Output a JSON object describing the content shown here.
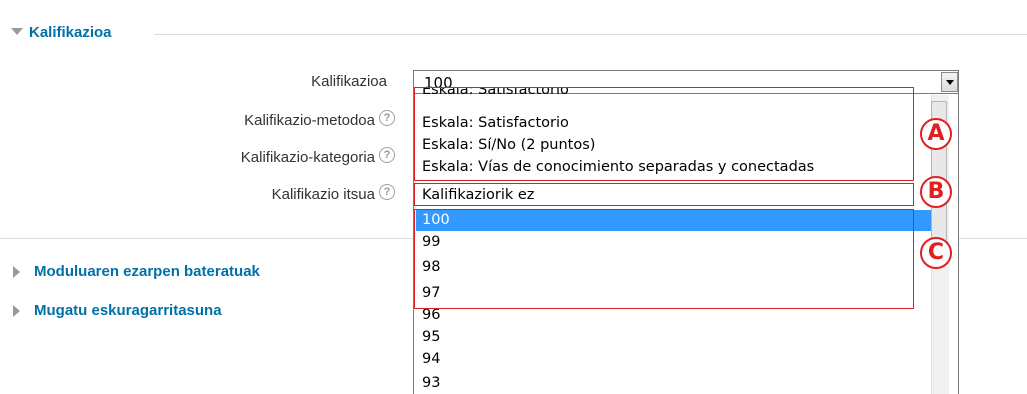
{
  "section": {
    "title": "Kalifikazioa"
  },
  "form": {
    "grade_label": "Kalifikazioa",
    "method_label": "Kalifikazio-metodoa",
    "category_label": "Kalifikazio-kategoria",
    "pass_label": "Kalifikazio itsua",
    "help_glyph": "?"
  },
  "select": {
    "value": "100",
    "options": [
      "Eskala: Satisfactorio",
      "Eskala: Satisfactorio",
      "Eskala: Sí/No (2 puntos)",
      "Eskala: Vías de conocimiento separadas y conectadas",
      "Kalifikaziorik ez",
      "100",
      "99",
      "98",
      "97",
      "96",
      "95",
      "94",
      "93"
    ],
    "selected_option": "100"
  },
  "annotations": {
    "a": "A",
    "b": "B",
    "c": "C"
  },
  "collapsed_sections": [
    "Moduluaren ezarpen bateratuak",
    "Mugatu eskuragarritasuna"
  ],
  "colors": {
    "link": "#0070a8",
    "selection": "#3399ff",
    "annotation": "#e02020"
  }
}
